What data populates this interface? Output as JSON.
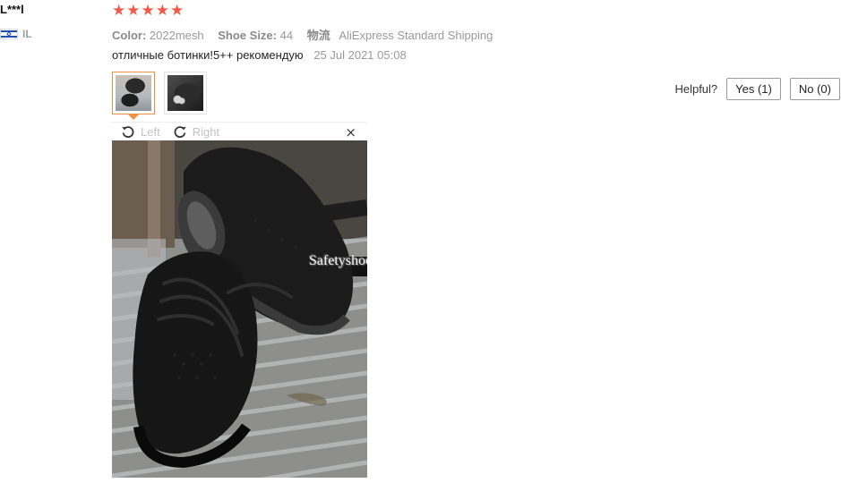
{
  "reviewer": {
    "name": "L***l",
    "country_code": "IL",
    "flag_icon": "israel-flag-icon"
  },
  "review": {
    "rating": 5,
    "stars": [
      "★",
      "★",
      "★",
      "★",
      "★"
    ],
    "star_color": "#f15a4a",
    "color_label": "Color:",
    "color_value": "2022mesh",
    "size_label": "Shoe Size:",
    "size_value": "44",
    "shipping_label": "物流",
    "shipping_value": "AliExpress Standard Shipping",
    "text": "отличные ботинки!5++ рекомендую",
    "date": "25 Jul 2021 05:08"
  },
  "helpful": {
    "question": "Helpful?",
    "yes_label": "Yes (1)",
    "no_label": "No (0)"
  },
  "viewer": {
    "rotate_left_label": "Left",
    "rotate_right_label": "Right",
    "close_glyph": "×",
    "watermark": "Safetyshoes Dropshipping Store"
  }
}
